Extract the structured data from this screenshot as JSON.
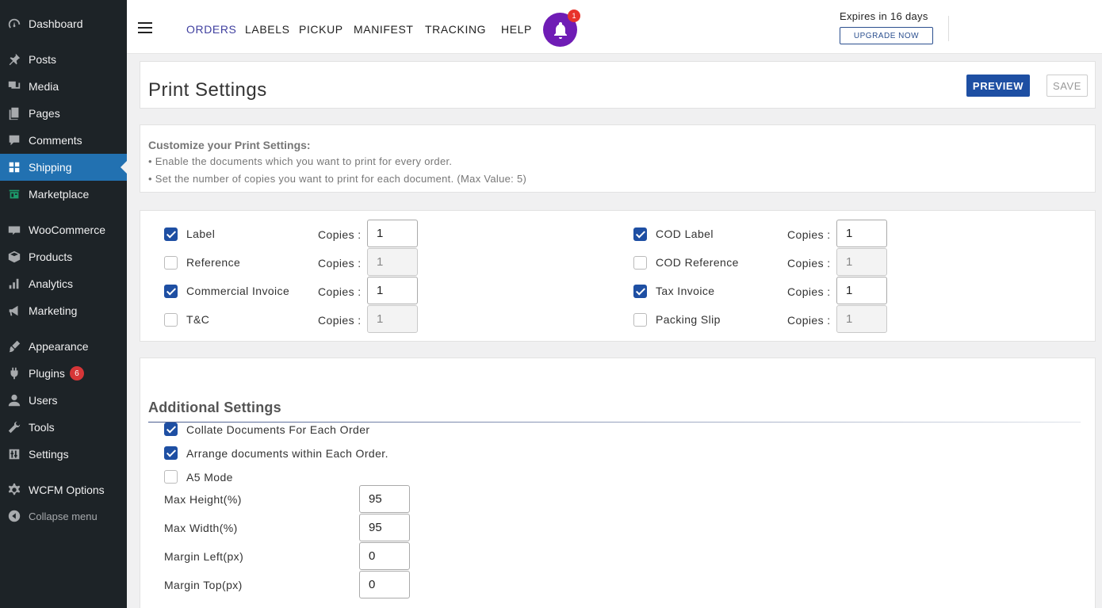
{
  "sidebar": {
    "items": [
      {
        "label": "Dashboard",
        "icon": "dashboard-icon"
      },
      {
        "label": "Posts",
        "icon": "pushpin-icon"
      },
      {
        "label": "Media",
        "icon": "media-icon"
      },
      {
        "label": "Pages",
        "icon": "pages-icon"
      },
      {
        "label": "Comments",
        "icon": "comment-icon"
      },
      {
        "label": "Shipping",
        "icon": "grid-icon",
        "active": true
      },
      {
        "label": "Marketplace",
        "icon": "marketplace-icon"
      },
      {
        "label": "WooCommerce",
        "icon": "woo-icon"
      },
      {
        "label": "Products",
        "icon": "box-icon"
      },
      {
        "label": "Analytics",
        "icon": "bar-chart-icon"
      },
      {
        "label": "Marketing",
        "icon": "megaphone-icon"
      },
      {
        "label": "Appearance",
        "icon": "brush-icon"
      },
      {
        "label": "Plugins",
        "icon": "plug-icon",
        "badge": "6"
      },
      {
        "label": "Users",
        "icon": "user-icon"
      },
      {
        "label": "Tools",
        "icon": "wrench-icon"
      },
      {
        "label": "Settings",
        "icon": "sliders-icon"
      },
      {
        "label": "WCFM Options",
        "icon": "gear-icon"
      },
      {
        "label": "Collapse menu",
        "icon": "collapse-icon"
      }
    ]
  },
  "topbar": {
    "nav": [
      "ORDERS",
      "LABELS",
      "PICKUP",
      "MANIFEST",
      "TRACKING",
      "HELP"
    ],
    "active_nav": "ORDERS",
    "notification_count": "1",
    "expires_text": "Expires in 16 days",
    "upgrade_label": "UPGRADE NOW"
  },
  "header": {
    "title": "Print Settings",
    "preview_label": "PREVIEW",
    "save_label": "SAVE"
  },
  "info": {
    "title": "Customize your Print Settings:",
    "lines": [
      "• Enable the documents which you want to print for every order.",
      "• Set the number of copies you want to print for each document. (Max Value: 5)"
    ]
  },
  "documents": {
    "copies_label": "Copies :",
    "left": [
      {
        "label": "Label",
        "checked": true,
        "copies": "1"
      },
      {
        "label": "Reference",
        "checked": false,
        "copies": "1"
      },
      {
        "label": "Commercial Invoice",
        "checked": true,
        "copies": "1"
      },
      {
        "label": "T&C",
        "checked": false,
        "copies": "1"
      }
    ],
    "right": [
      {
        "label": "COD Label",
        "checked": true,
        "copies": "1"
      },
      {
        "label": "COD Reference",
        "checked": false,
        "copies": "1"
      },
      {
        "label": "Tax Invoice",
        "checked": true,
        "copies": "1"
      },
      {
        "label": "Packing Slip",
        "checked": false,
        "copies": "1"
      }
    ]
  },
  "additional": {
    "title": "Additional Settings",
    "options": [
      {
        "label": "Collate Documents For Each Order",
        "checked": true
      },
      {
        "label": "Arrange documents within Each Order.",
        "checked": true
      },
      {
        "label": "A5 Mode",
        "checked": false
      }
    ],
    "fields": [
      {
        "label": "Max Height(%)",
        "value": "95"
      },
      {
        "label": "Max Width(%)",
        "value": "95"
      },
      {
        "label": "Margin Left(px)",
        "value": "0"
      },
      {
        "label": "Margin Top(px)",
        "value": "0"
      }
    ]
  }
}
